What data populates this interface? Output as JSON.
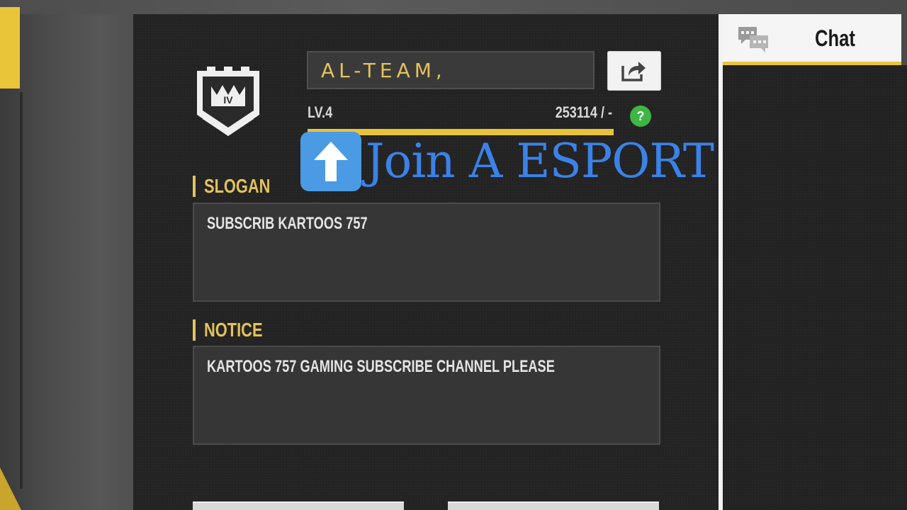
{
  "guild": {
    "name": "AL-TEAM,",
    "level_label": "LV.4",
    "exp_label": "253114 / -",
    "exp_progress": 1.0,
    "help_glyph": "?"
  },
  "overlay": {
    "caption": "Join A ESPORT GUILD",
    "arrow_icon": "up-arrow-icon"
  },
  "slogan": {
    "label": "SLOGAN",
    "text": "SUBSCRIB KARTOOS 757"
  },
  "notice": {
    "label": "NOTICE",
    "text": "KARTOOS 757 GAMING SUBSCRIBE CHANNEL PLEASE"
  },
  "chat": {
    "title": "Chat",
    "icon": "chat-bubbles-icon"
  },
  "colors": {
    "accent_yellow": "#e3c25c",
    "bar_yellow": "#e7c33b",
    "help_green": "#3fb545",
    "overlay_blue": "#3b82e8"
  }
}
